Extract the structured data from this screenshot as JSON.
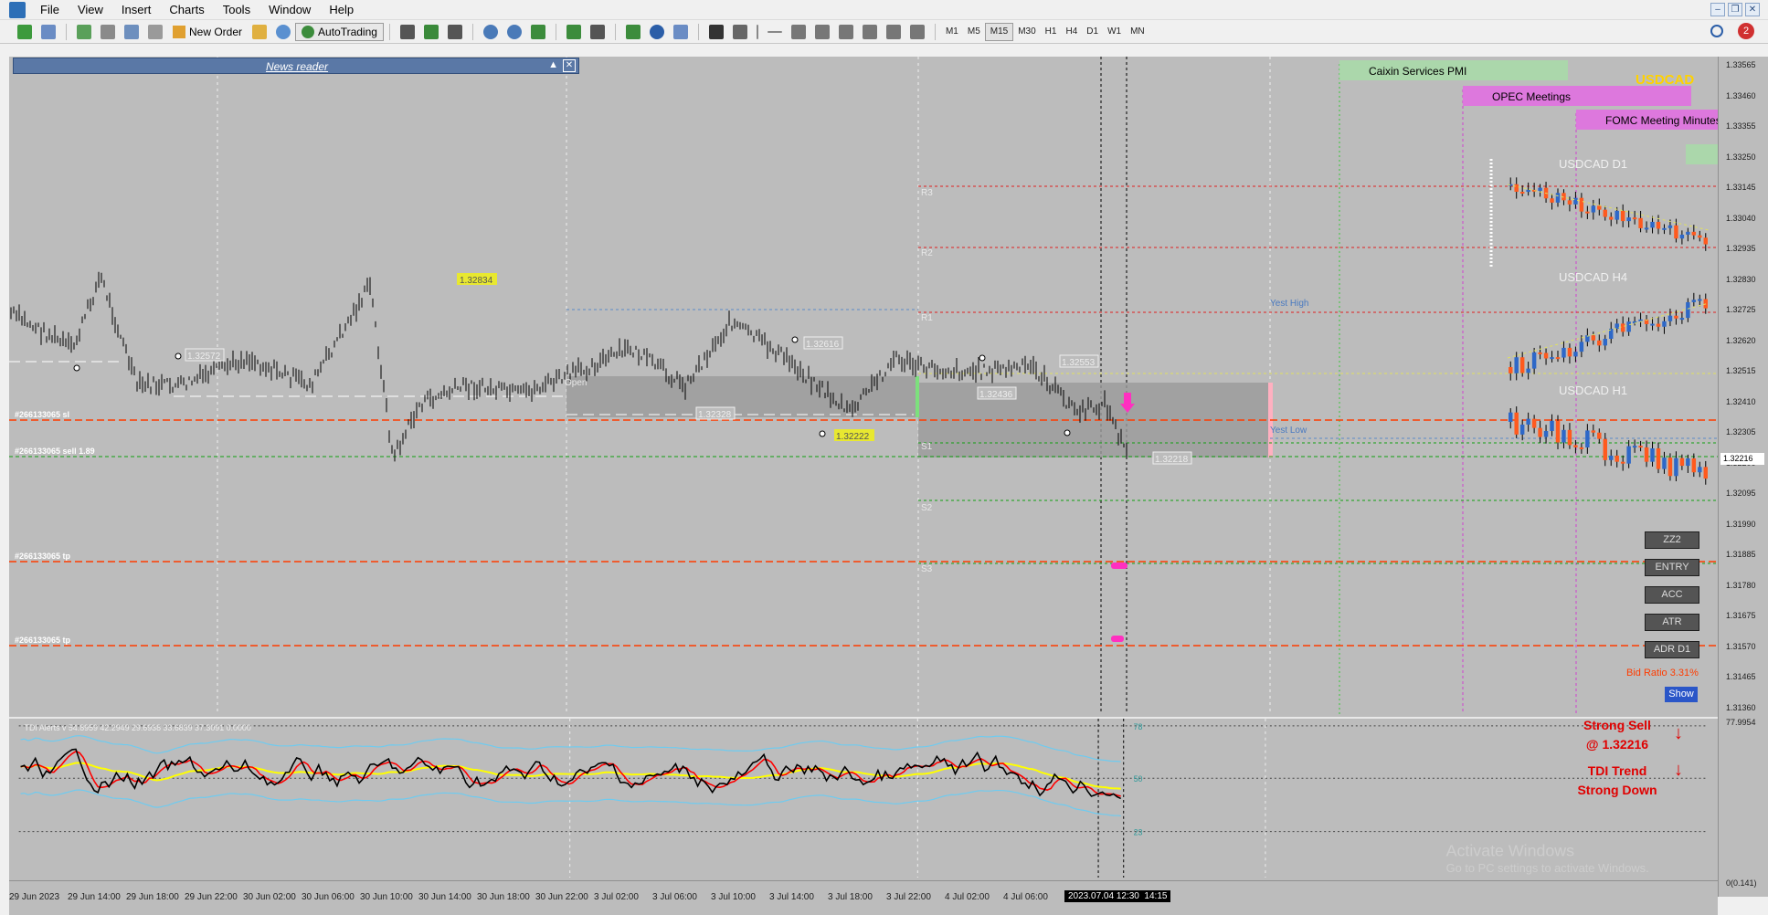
{
  "menu": {
    "items": [
      "File",
      "View",
      "Insert",
      "Charts",
      "Tools",
      "Window",
      "Help"
    ]
  },
  "toolbar": {
    "new_order": "New Order",
    "autotrading": "AutoTrading",
    "timeframes": [
      "M1",
      "M5",
      "M15",
      "M30",
      "H1",
      "H4",
      "D1",
      "W1",
      "MN"
    ],
    "active_timeframe": "M15",
    "notification_count": "2"
  },
  "news_reader": {
    "title": "News reader"
  },
  "events": [
    {
      "label": "Caixin Services PMI",
      "color": "#9fd89f"
    },
    {
      "label": "OPEC Meetings",
      "color": "#e070e0"
    },
    {
      "label": "FOMC Meeting Minutes",
      "color": "#e070e0"
    }
  ],
  "symbol": {
    "name": "USDCAD",
    "color": "#ffd200"
  },
  "mini_charts": [
    {
      "label": "USDCAD D1"
    },
    {
      "label": "USDCAD H4"
    },
    {
      "label": "USDCAD H1"
    }
  ],
  "levels": {
    "r3": "R3",
    "r2": "R2",
    "r1": "R1",
    "s1": "S1",
    "s2": "S2",
    "s3": "S3",
    "yest_high": "Yest High",
    "yest_low": "Yest Low",
    "open": "Open"
  },
  "order_lines": {
    "sl": "#266133065 sl",
    "sell": "#266133065 sell 1.89",
    "tp1": "#266133065 tp",
    "tp2": "#266133065 tp"
  },
  "price_tags": {
    "p1": "1.32834",
    "p2": "1.32572",
    "p3": "1.32616",
    "p4": "1.32328",
    "p5": "1.32222",
    "p6": "1.32553",
    "p7": "1.32436",
    "p8": "1.32218",
    "current": "1.32216"
  },
  "side_buttons": [
    "ZZ2",
    "ENTRY",
    "ACC",
    "ATR",
    "ADR D1"
  ],
  "bid_ratio": "Bid Ratio 3.31%",
  "show_button": "Show",
  "indicator": {
    "title": "TDI Alerts v 54.8959 42.2949 29.6938 33.6839 37.3091 0.0000",
    "levels": [
      "78",
      "50",
      "23"
    ],
    "axis_top": "77.9954",
    "axis_bottom": "0(0.141)"
  },
  "signals": {
    "line1": "Strong Sell",
    "line2": "@ 1.32216",
    "line3": "TDI Trend",
    "line4": "Strong Down"
  },
  "price_axis": [
    "1.33565",
    "1.33460",
    "1.33355",
    "1.33250",
    "1.33145",
    "1.33040",
    "1.32935",
    "1.32830",
    "1.32725",
    "1.32620",
    "1.32515",
    "1.32410",
    "1.32305",
    "1.32200",
    "1.32095",
    "1.31990",
    "1.31885",
    "1.31780",
    "1.31675",
    "1.31570",
    "1.31465",
    "1.31360"
  ],
  "time_axis": [
    "29 Jun 2023",
    "29 Jun 14:00",
    "29 Jun 18:00",
    "29 Jun 22:00",
    "30 Jun 02:00",
    "30 Jun 06:00",
    "30 Jun 10:00",
    "30 Jun 14:00",
    "30 Jun 18:00",
    "30 Jun 22:00",
    "3 Jul 02:00",
    "3 Jul 06:00",
    "3 Jul 10:00",
    "3 Jul 14:00",
    "3 Jul 18:00",
    "3 Jul 22:00",
    "4 Jul 02:00",
    "4 Jul 06:00"
  ],
  "cursor_time": "2023.07.04 12:30",
  "cursor_time2": "14:15",
  "watermark": {
    "line1": "Activate Windows",
    "line2": "Go to PC settings to activate Windows."
  },
  "colors": {
    "chart_bg": "#bcbcbc",
    "bull": "#2e68c8",
    "bear": "#ff5a1e",
    "tdi_green": "#000000",
    "tdi_red": "#ff0000",
    "tdi_yellow": "#ffff00",
    "tdi_band": "#6ecbf0"
  }
}
